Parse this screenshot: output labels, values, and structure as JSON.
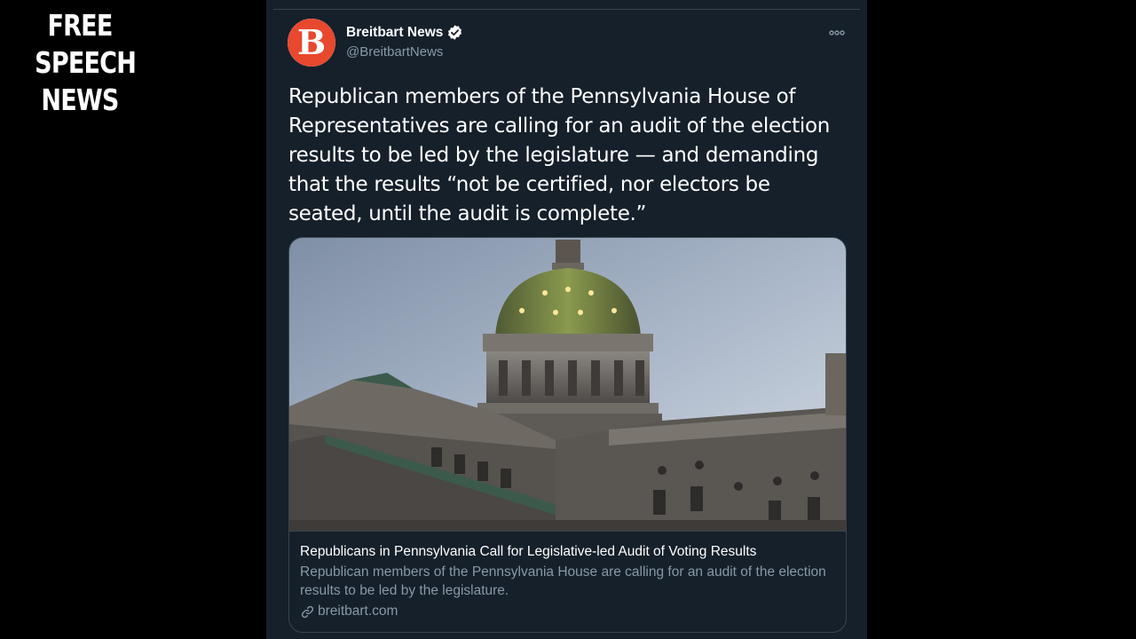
{
  "watermark": {
    "lines": [
      "FREE",
      "SPEECH",
      "NEWS"
    ]
  },
  "tweet": {
    "author_name": "Breitbart News",
    "author_handle": "@BreitbartNews",
    "avatar_letter": "B",
    "text": "Republican members of the Pennsylvania House of Representatives are calling for an audit of the election results to be led by the legislature — and demanding that the results “not be certified, nor electors be seated, until the audit is complete.”",
    "card": {
      "title": "Republicans in Pennsylvania Call for Legislative-led Audit of Voting Results",
      "description": "Republican members of the Pennsylvania House are calling for an audit of the election results to be led by the legislature.",
      "domain": "breitbart.com"
    }
  },
  "icons": [
    "verified-badge-icon",
    "more-options-icon",
    "link-icon"
  ],
  "colors": {
    "panel_bg": "#15202b",
    "border": "#38444d",
    "secondary_text": "#8899a6",
    "brand_orange": "#e8482d",
    "verified_blue": "#ffffff"
  }
}
